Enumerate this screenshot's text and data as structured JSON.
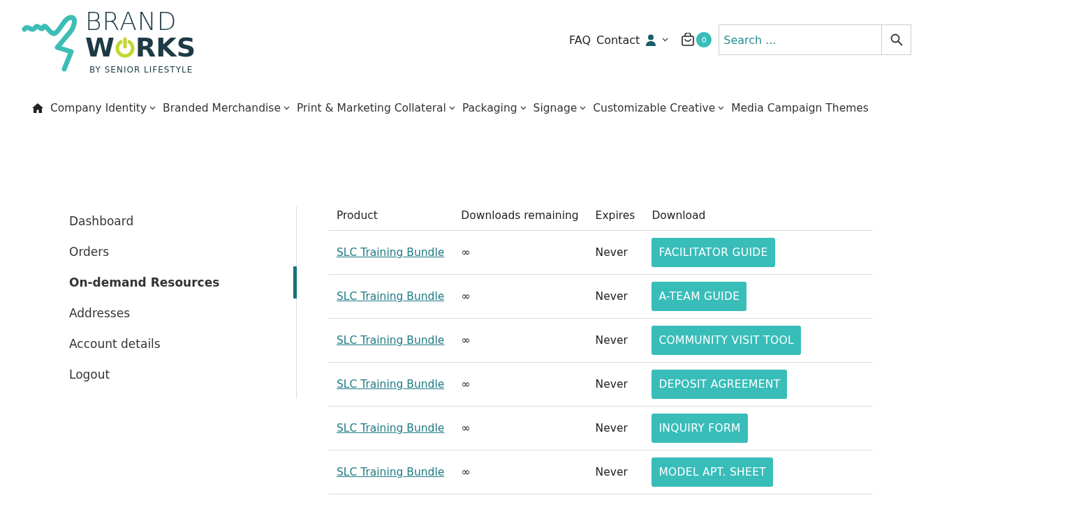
{
  "logo": {
    "top": "BRAND",
    "bottom_left": "W",
    "bottom_right": "RKS",
    "tagline": "BY SENIOR LIFESTYLE"
  },
  "top_links": [
    "FAQ",
    "Contact"
  ],
  "cart": {
    "count": "0"
  },
  "search": {
    "placeholder": "Search ..."
  },
  "nav": [
    {
      "label": "Company Identity",
      "has_menu": true
    },
    {
      "label": "Branded Merchandise",
      "has_menu": true
    },
    {
      "label": "Print & Marketing Collateral",
      "has_menu": true
    },
    {
      "label": "Packaging",
      "has_menu": true
    },
    {
      "label": "Signage",
      "has_menu": true
    },
    {
      "label": "Customizable Creative",
      "has_menu": true
    },
    {
      "label": "Media Campaign Themes",
      "has_menu": false
    }
  ],
  "sidebar": {
    "items": [
      {
        "label": "Dashboard",
        "selected": false
      },
      {
        "label": "Orders",
        "selected": false
      },
      {
        "label": "On-demand Resources",
        "selected": true
      },
      {
        "label": "Addresses",
        "selected": false
      },
      {
        "label": "Account details",
        "selected": false
      },
      {
        "label": "Logout",
        "selected": false
      }
    ]
  },
  "table": {
    "columns": [
      "Product",
      "Downloads remaining",
      "Expires",
      "Download"
    ],
    "rows": [
      {
        "product": "SLC Training Bundle",
        "remaining": "∞",
        "expires": "Never",
        "download": "FACILITATOR GUIDE"
      },
      {
        "product": "SLC Training Bundle",
        "remaining": "∞",
        "expires": "Never",
        "download": "A-TEAM GUIDE"
      },
      {
        "product": "SLC Training Bundle",
        "remaining": "∞",
        "expires": "Never",
        "download": "COMMUNITY VISIT TOOL"
      },
      {
        "product": "SLC Training Bundle",
        "remaining": "∞",
        "expires": "Never",
        "download": "DEPOSIT AGREEMENT"
      },
      {
        "product": "SLC Training Bundle",
        "remaining": "∞",
        "expires": "Never",
        "download": "INQUIRY FORM"
      },
      {
        "product": "SLC Training Bundle",
        "remaining": "∞",
        "expires": "Never",
        "download": "MODEL APT. SHEET"
      }
    ]
  }
}
